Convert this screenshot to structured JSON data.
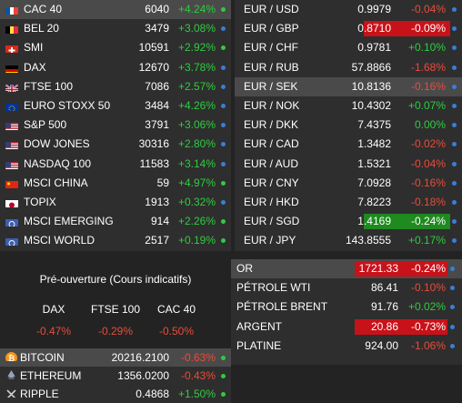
{
  "indices": [
    {
      "name": "CAC 40",
      "value": "6040",
      "change": "+4.24%",
      "dir": "up",
      "dot": "green",
      "flag": "fr",
      "highlight": true
    },
    {
      "name": "BEL 20",
      "value": "3479",
      "change": "+3.08%",
      "dir": "up",
      "dot": "blue",
      "flag": "be"
    },
    {
      "name": "SMI",
      "value": "10591",
      "change": "+2.92%",
      "dir": "up",
      "dot": "green",
      "flag": "ch"
    },
    {
      "name": "DAX",
      "value": "12670",
      "change": "+3.78%",
      "dir": "up",
      "dot": "blue",
      "flag": "de"
    },
    {
      "name": "FTSE 100",
      "value": "7086",
      "change": "+2.57%",
      "dir": "up",
      "dot": "blue",
      "flag": "gb"
    },
    {
      "name": "EURO STOXX 50",
      "value": "3484",
      "change": "+4.26%",
      "dir": "up",
      "dot": "blue",
      "flag": "eu"
    },
    {
      "name": "S&P 500",
      "value": "3791",
      "change": "+3.06%",
      "dir": "up",
      "dot": "blue",
      "flag": "us"
    },
    {
      "name": "DOW JONES",
      "value": "30316",
      "change": "+2.80%",
      "dir": "up",
      "dot": "blue",
      "flag": "us"
    },
    {
      "name": "NASDAQ 100",
      "value": "11583",
      "change": "+3.14%",
      "dir": "up",
      "dot": "blue",
      "flag": "us"
    },
    {
      "name": "MSCI CHINA",
      "value": "59",
      "change": "+4.97%",
      "dir": "up",
      "dot": "green",
      "flag": "cn"
    },
    {
      "name": "TOPIX",
      "value": "1913",
      "change": "+0.32%",
      "dir": "up",
      "dot": "blue",
      "flag": "jp"
    },
    {
      "name": "MSCI EMERGING",
      "value": "914",
      "change": "+2.26%",
      "dir": "up",
      "dot": "green",
      "flag": "un"
    },
    {
      "name": "MSCI WORLD",
      "value": "2517",
      "change": "+0.19%",
      "dir": "up",
      "dot": "green",
      "flag": "un"
    }
  ],
  "preopen": {
    "title": "Pré-ouverture (Cours indicatifs)",
    "cols": [
      {
        "name": "DAX",
        "change": "-0.47%"
      },
      {
        "name": "FTSE 100",
        "change": "-0.29%"
      },
      {
        "name": "CAC 40",
        "change": "-0.50%"
      }
    ]
  },
  "crypto": [
    {
      "name": "BITCOIN",
      "value": "20216.2100",
      "change": "-0.63%",
      "dir": "down",
      "dot": "green",
      "icon": "btc",
      "highlight": true
    },
    {
      "name": "ETHEREUM",
      "value": "1356.0200",
      "change": "-0.43%",
      "dir": "down",
      "dot": "green",
      "icon": "eth"
    },
    {
      "name": "RIPPLE",
      "value": "0.4868",
      "change": "+1.50%",
      "dir": "up",
      "dot": "green",
      "icon": "xrp"
    }
  ],
  "forex": [
    {
      "name": "EUR / USD",
      "value": "0.9979",
      "change": "-0.04%",
      "dir": "down",
      "dot": "blue"
    },
    {
      "name": "EUR / GBP",
      "value": "0.8710",
      "change": "-0.09%",
      "dir": "down",
      "dot": "blue",
      "box": "red"
    },
    {
      "name": "EUR / CHF",
      "value": "0.9781",
      "change": "+0.10%",
      "dir": "up",
      "dot": "blue"
    },
    {
      "name": "EUR / RUB",
      "value": "57.8866",
      "change": "-1.68%",
      "dir": "down",
      "dot": "blue"
    },
    {
      "name": "EUR / SEK",
      "value": "10.8136",
      "change": "-0.16%",
      "dir": "down",
      "dot": "blue",
      "highlight": true
    },
    {
      "name": "EUR / NOK",
      "value": "10.4302",
      "change": "+0.07%",
      "dir": "up",
      "dot": "blue"
    },
    {
      "name": "EUR / DKK",
      "value": "7.4375",
      "change": "0.00%",
      "dir": "up",
      "dot": "blue"
    },
    {
      "name": "EUR / CAD",
      "value": "1.3482",
      "change": "-0.02%",
      "dir": "down",
      "dot": "blue"
    },
    {
      "name": "EUR / AUD",
      "value": "1.5321",
      "change": "-0.04%",
      "dir": "down",
      "dot": "blue"
    },
    {
      "name": "EUR / CNY",
      "value": "7.0928",
      "change": "-0.16%",
      "dir": "down",
      "dot": "blue"
    },
    {
      "name": "EUR / HKD",
      "value": "7.8223",
      "change": "-0.18%",
      "dir": "down",
      "dot": "blue"
    },
    {
      "name": "EUR / SGD",
      "value": "1.4169",
      "change": "-0.24%",
      "dir": "down",
      "dot": "blue",
      "box": "green"
    },
    {
      "name": "EUR / JPY",
      "value": "143.8555",
      "change": "+0.17%",
      "dir": "up",
      "dot": "blue"
    }
  ],
  "commodities": [
    {
      "name": "OR",
      "value": "1721.33",
      "change": "-0.24%",
      "dir": "down",
      "dot": "blue",
      "box": "red",
      "highlight": true
    },
    {
      "name": "PÉTROLE WTI",
      "value": "86.41",
      "change": "-0.10%",
      "dir": "down",
      "dot": "blue"
    },
    {
      "name": "PÉTROLE BRENT",
      "value": "91.76",
      "change": "+0.02%",
      "dir": "up",
      "dot": "blue"
    },
    {
      "name": "ARGENT",
      "value": "20.86",
      "change": "-0.73%",
      "dir": "down",
      "dot": "blue",
      "box": "red"
    },
    {
      "name": "PLATINE",
      "value": "924.00",
      "change": "-1.06%",
      "dir": "down",
      "dot": "blue"
    }
  ]
}
